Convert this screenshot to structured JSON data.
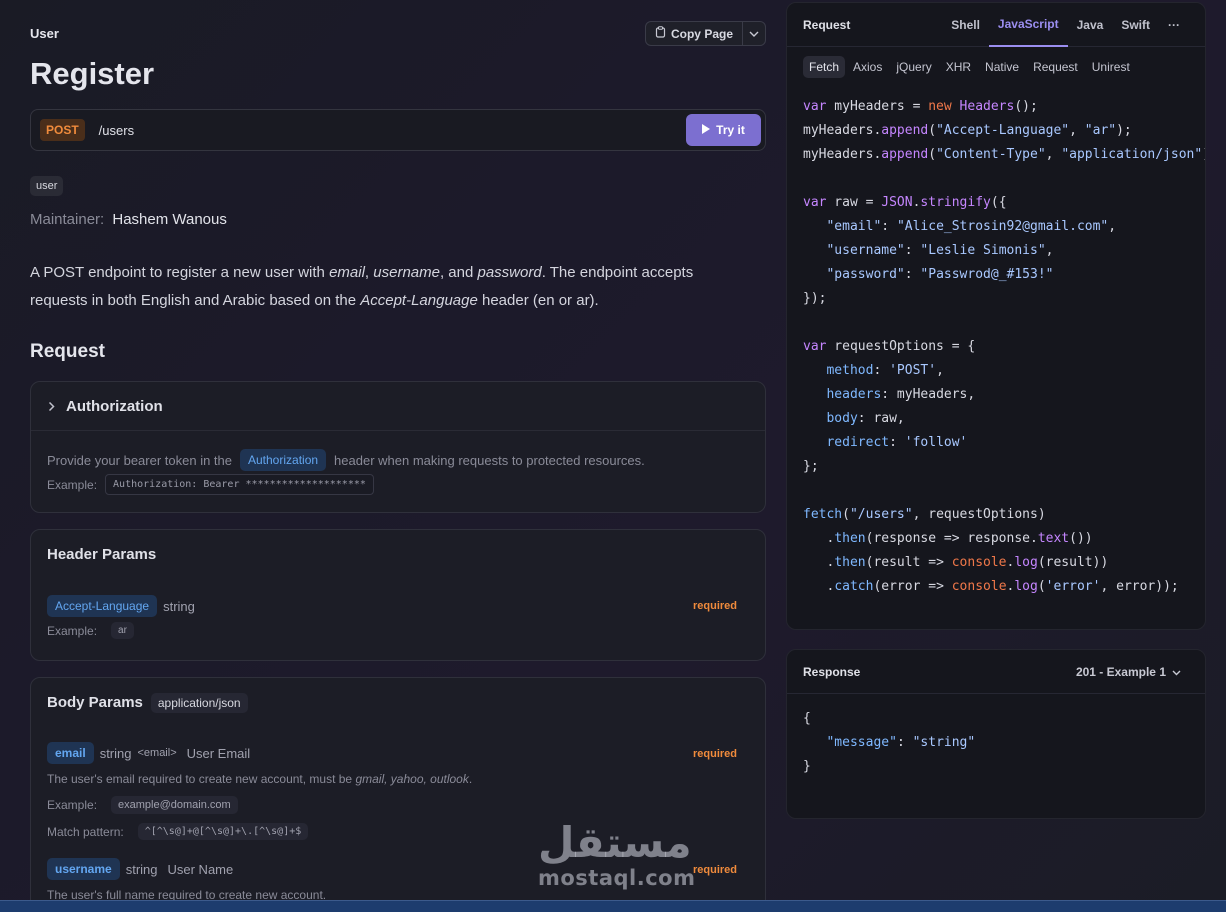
{
  "header": {
    "breadcrumb": "User",
    "copy_page": "Copy Page",
    "title": "Register"
  },
  "endpoint": {
    "method": "POST",
    "path": "/users",
    "try_label": "Try it"
  },
  "tag": "user",
  "maintainer": {
    "label": "Maintainer:",
    "name": "Hashem Wanous"
  },
  "description": {
    "p1": "A POST endpoint to register a new user with ",
    "e1": "email",
    "p2": ", ",
    "e2": "username",
    "p3": ", and ",
    "e3": "password",
    "p4": ". The endpoint accepts requests in both English and Arabic based on the ",
    "e4": "Accept-Language",
    "p5": " header (en or ar)."
  },
  "request_heading": "Request",
  "authorization": {
    "title": "Authorization",
    "text_before": "Provide your bearer token in the",
    "pill": "Authorization",
    "text_after": "header when making requests to protected resources.",
    "example_label": "Example:",
    "example_value": "Authorization: Bearer ********************"
  },
  "header_params": {
    "title": "Header Params",
    "name": "Accept-Language",
    "type": "string",
    "required": "required",
    "example_label": "Example:",
    "example_value": "ar"
  },
  "body_params": {
    "title": "Body Params",
    "content_type": "application/json",
    "email": {
      "name": "email",
      "type": "string",
      "format": "<email>",
      "title": "User Email",
      "required": "required",
      "desc": "The user's email required to create new account, must be ",
      "desc_em": "gmail, yahoo, outlook",
      "desc_end": ".",
      "example_label": "Example:",
      "example_value": "example@domain.com",
      "pattern_label": "Match pattern:",
      "pattern_value": "^[^\\s@]+@[^\\s@]+\\.[^\\s@]+$"
    },
    "username": {
      "name": "username",
      "type": "string",
      "title": "User Name",
      "required": "required",
      "desc": "The user's full name required to create new account."
    }
  },
  "code_panel": {
    "title": "Request",
    "languages": [
      "Shell",
      "JavaScript",
      "Java",
      "Swift",
      "···"
    ],
    "active_language": "JavaScript",
    "libraries": [
      "Fetch",
      "Axios",
      "jQuery",
      "XHR",
      "Native",
      "Request",
      "Unirest"
    ],
    "active_library": "Fetch"
  },
  "response_panel": {
    "title": "Response",
    "selector": "201 - Example 1"
  },
  "watermark": {
    "arabic": "مستقل",
    "latin": "mostaql.com"
  },
  "colors": {
    "accent": "#7c6fd0",
    "post": "#f08b3c",
    "param": "#63a6f0",
    "required": "#f08b3c"
  }
}
